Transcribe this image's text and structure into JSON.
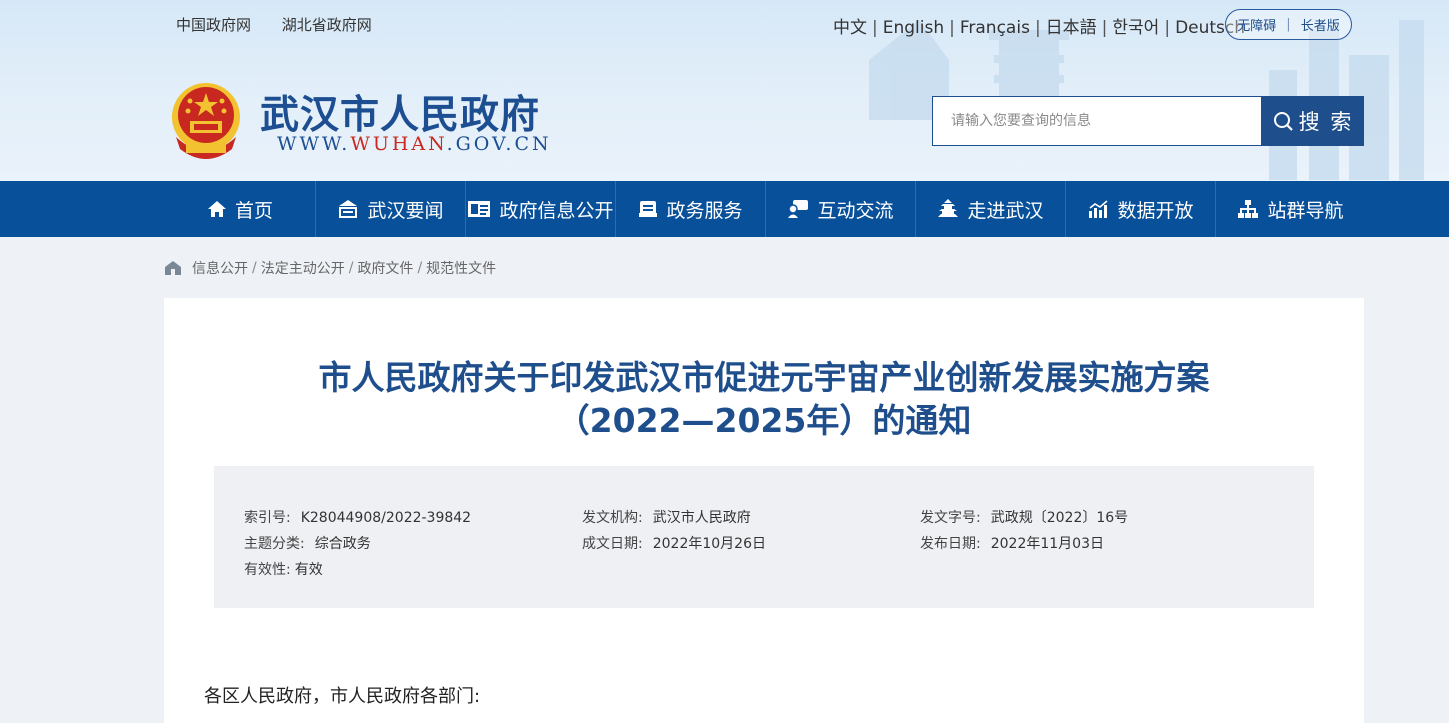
{
  "header": {
    "top_links": [
      "中国政府网",
      "湖北省政府网"
    ],
    "languages": [
      "中文",
      "English",
      "Français",
      "日本語",
      "한국어",
      "Deutsch"
    ],
    "accessibility": {
      "barrier_free": "无障碍",
      "elderly": "长者版"
    },
    "site_title": "武汉市人民政府",
    "site_url_prefix": "WWW.",
    "site_url_highlight": "WUHAN",
    "site_url_suffix": ".GOV.CN",
    "search": {
      "placeholder": "请输入您要查询的信息",
      "button_label": "搜 索"
    }
  },
  "nav": {
    "items": [
      {
        "label": "首页",
        "icon": "home-icon"
      },
      {
        "label": "武汉要闻",
        "icon": "news-icon"
      },
      {
        "label": "政府信息公开",
        "icon": "info-card-icon"
      },
      {
        "label": "政务服务",
        "icon": "service-icon"
      },
      {
        "label": "互动交流",
        "icon": "chat-icon"
      },
      {
        "label": "走进武汉",
        "icon": "tower-icon"
      },
      {
        "label": "数据开放",
        "icon": "chart-icon"
      },
      {
        "label": "站群导航",
        "icon": "sitemap-icon"
      }
    ]
  },
  "breadcrumb": [
    "信息公开",
    "法定主动公开",
    "政府文件",
    "规范性文件"
  ],
  "document": {
    "title_line1": "市人民政府关于印发武汉市促进元宇宙产业创新发展实施方案",
    "title_line2": "（2022—2025年）的通知",
    "meta": {
      "index_label": "索引号:",
      "index_value": "K28044908/2022-39842",
      "agency_label": "发文机构:",
      "agency_value": "武汉市人民政府",
      "docno_label": "发文字号:",
      "docno_value": "武政规〔2022〕16号",
      "topic_label": "主题分类:",
      "topic_value": "综合政务",
      "date_label": "成文日期:",
      "date_value": "2022年10月26日",
      "pubdate_label": "发布日期:",
      "pubdate_value": "2022年11月03日",
      "validity_label": "有效性:",
      "validity_value": "有效"
    },
    "greeting": "各区人民政府，市人民政府各部门:"
  },
  "colors": {
    "brand_blue": "#08509a",
    "title_blue": "#1f4e8c",
    "emblem_red": "#c8281f",
    "emblem_gold": "#f2c230"
  }
}
